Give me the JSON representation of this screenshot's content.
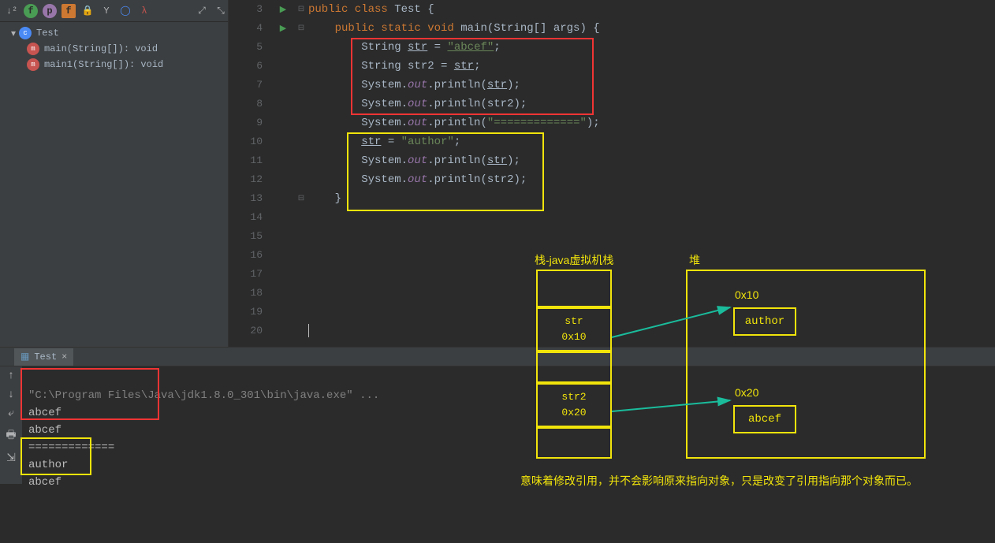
{
  "structure": {
    "class_name": "Test",
    "methods": [
      {
        "label": "main(String[]): void"
      },
      {
        "label": "main1(String[]): void"
      }
    ]
  },
  "code": {
    "lines": [
      3,
      4,
      5,
      6,
      7,
      8,
      9,
      10,
      11,
      12,
      13,
      14,
      15,
      16,
      17,
      18,
      19,
      20
    ],
    "l3_a": "public class ",
    "l3_b": "Test {",
    "l4_a": "    public static void ",
    "l4_b": "main",
    "l4_c": "(String[] args) {",
    "l5_a": "        String ",
    "l5_b": "str",
    "l5_c": " = ",
    "l5_d": "\"abcef\"",
    "l5_e": ";",
    "l6_a": "        String str2 = ",
    "l6_b": "str",
    "l6_c": ";",
    "l7_a": "        System.",
    "l7_b": "out",
    "l7_c": ".println(",
    "l7_d": "str",
    "l7_e": ");",
    "l8_a": "        System.",
    "l8_b": "out",
    "l8_c": ".println(str2);",
    "l9_a": "        System.",
    "l9_b": "out",
    "l9_c": ".println(",
    "l9_d": "\"=============\"",
    "l9_e": ");",
    "l10_a": "        ",
    "l10_b": "str",
    "l10_c": " = ",
    "l10_d": "\"author\"",
    "l10_e": ";",
    "l11_a": "        System.",
    "l11_b": "out",
    "l11_c": ".println(",
    "l11_d": "str",
    "l11_e": ");",
    "l12_a": "        System.",
    "l12_b": "out",
    "l12_c": ".println(str2);",
    "l13": "    }"
  },
  "run": {
    "tab": "Test",
    "path": "\"C:\\Program Files\\Java\\jdk1.8.0_301\\bin\\java.exe\" ...",
    "out1": "abcef",
    "out2": "abcef",
    "sep": "=============",
    "out3": "author",
    "out4": "abcef"
  },
  "diagram": {
    "stack_title": "栈-java虚拟机栈",
    "heap_title": "堆",
    "str_name": "str",
    "str_addr": "0x10",
    "str2_name": "str2",
    "str2_addr": "0x20",
    "obj1_addr": "0x10",
    "obj1_val": "author",
    "obj2_addr": "0x20",
    "obj2_val": "abcef",
    "caption": "意味着修改引用，并不会影响原来指向对象，只是改变了引用指向那个对象而已。"
  }
}
